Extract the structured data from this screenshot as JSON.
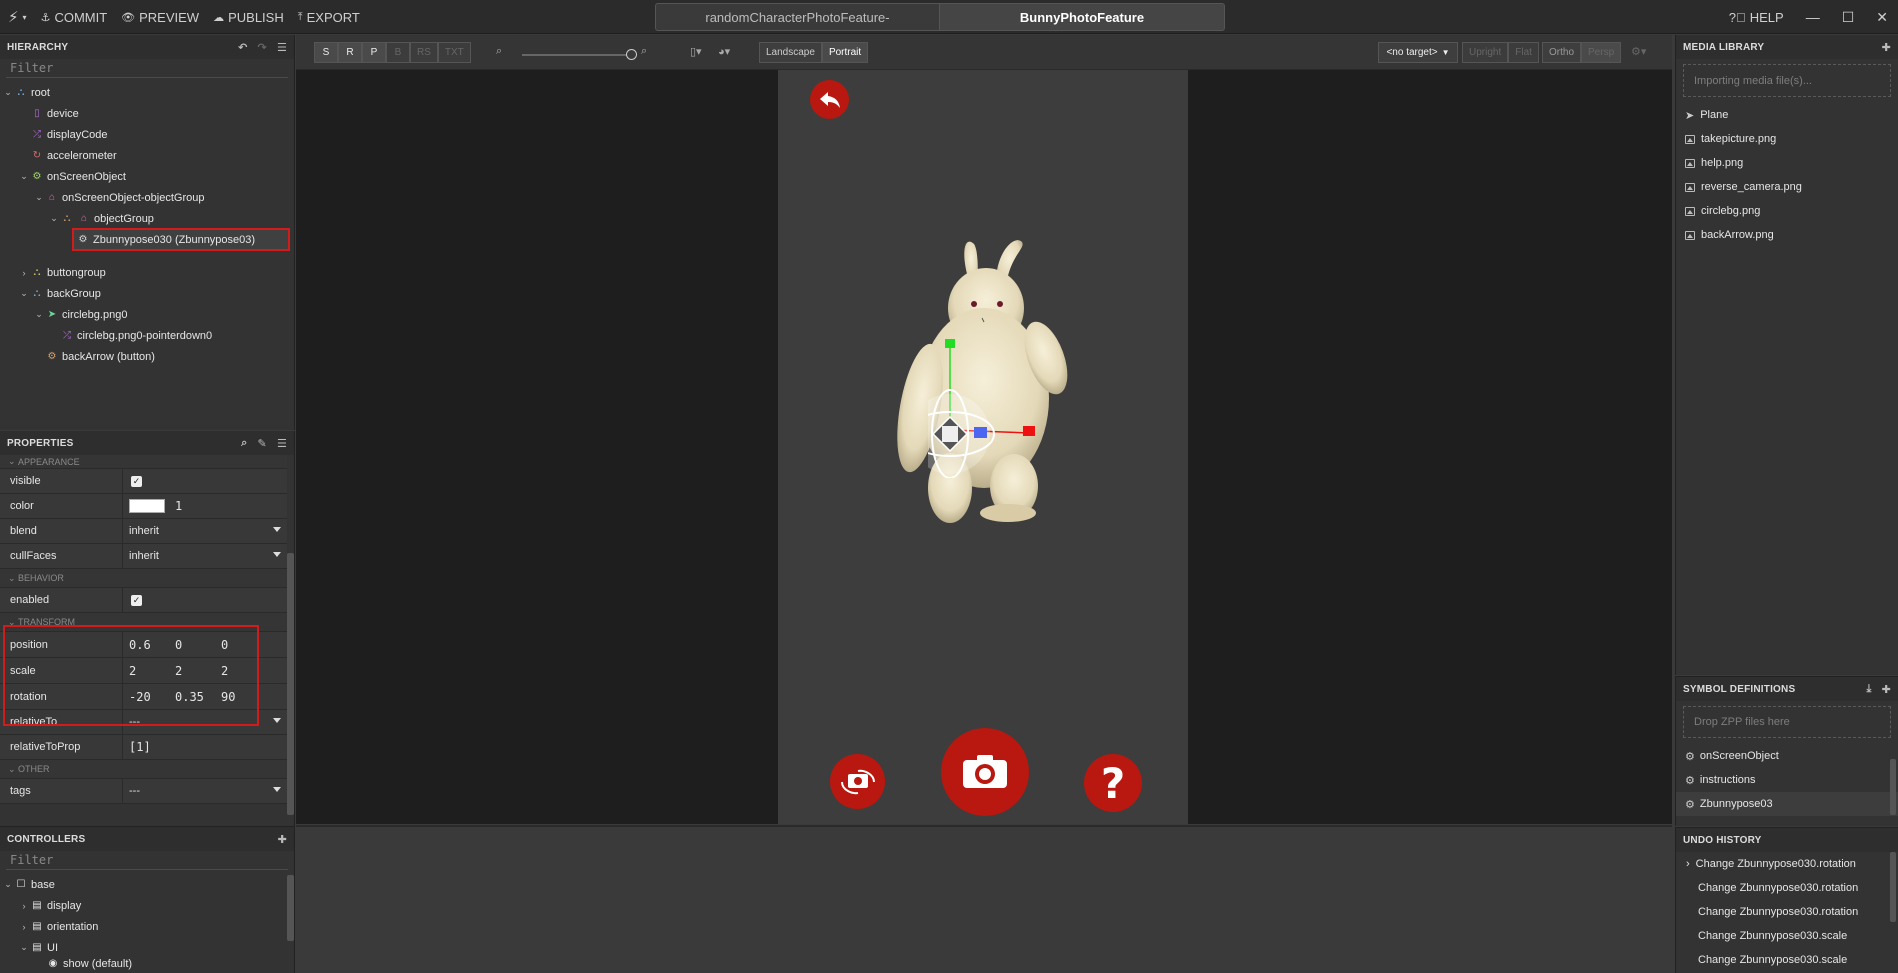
{
  "topbar": {
    "commit": "COMMIT",
    "preview": "PREVIEW",
    "publish": "PUBLISH",
    "export": "EXPORT",
    "tabs": [
      "randomCharacterPhotoFeature-",
      "BunnyPhotoFeature"
    ],
    "help": "HELP"
  },
  "hierarchy": {
    "title": "HIERARCHY",
    "filter_placeholder": "Filter",
    "items": [
      {
        "label": "root",
        "icon": "group-icon",
        "color": "#7ab3e0"
      },
      {
        "label": "device",
        "icon": "device-icon",
        "color": "#b26bd6"
      },
      {
        "label": "displayCode",
        "icon": "shuffle-icon",
        "color": "#b26bd6"
      },
      {
        "label": "accelerometer",
        "icon": "refresh-icon",
        "color": "#d66b6b"
      },
      {
        "label": "onScreenObject",
        "icon": "gear-icon",
        "color": "#9fd66b"
      },
      {
        "label": "onScreenObject-objectGroup",
        "icon": "tag-icon",
        "color": "#d66bb2"
      },
      {
        "label": "objectGroup",
        "icon": "group-icon",
        "color": "#d6a06b"
      },
      {
        "label": "Zbunnypose030 (Zbunnypose03)",
        "icon": "gear-icon",
        "color": "#d6d6d6"
      },
      {
        "label": "buttongroup",
        "icon": "group-icon",
        "color": "#d6c96b"
      },
      {
        "label": "backGroup",
        "icon": "group-icon",
        "color": "#7ab3e0"
      },
      {
        "label": "circlebg.png0",
        "icon": "plane-icon",
        "color": "#6bd69a"
      },
      {
        "label": "circlebg.png0-pointerdown0",
        "icon": "shuffle-icon",
        "color": "#b26bd6"
      },
      {
        "label": "backArrow (button)",
        "icon": "gear-icon",
        "color": "#d6a06b"
      }
    ]
  },
  "properties": {
    "title": "PROPERTIES",
    "sections": {
      "appearance": "APPEARANCE",
      "behavior": "BEHAVIOR",
      "transform": "TRANSFORM",
      "other": "OTHER"
    },
    "visible_label": "visible",
    "color_label": "color",
    "color_value": "1",
    "blend_label": "blend",
    "blend_value": "inherit",
    "cullfaces_label": "cullFaces",
    "cullfaces_value": "inherit",
    "enabled_label": "enabled",
    "position_label": "position",
    "position": [
      "0.6",
      "0",
      "0"
    ],
    "scale_label": "scale",
    "scale": [
      "2",
      "2",
      "2"
    ],
    "rotation_label": "rotation",
    "rotation": [
      "-20",
      "0.35",
      "90"
    ],
    "relativeto_label": "relativeTo",
    "relativeto_value": "---",
    "relativetoprop_label": "relativeToProp",
    "relativetoprop_value": "[1]",
    "tags_label": "tags",
    "tags_value": "---"
  },
  "controllers": {
    "title": "CONTROLLERS",
    "filter_placeholder": "Filter",
    "items": [
      "base",
      "display",
      "orientation",
      "UI",
      "show (default)"
    ]
  },
  "viewport_toolbar": {
    "modes": [
      "S",
      "R",
      "P",
      "B",
      "RS",
      "TXT"
    ],
    "landscape": "Landscape",
    "portrait": "Portrait",
    "target": "<no target>",
    "upright": "Upright",
    "flat": "Flat",
    "ortho": "Ortho",
    "persp": "Persp"
  },
  "media_library": {
    "title": "MEDIA LIBRARY",
    "drop_text": "Importing media file(s)...",
    "items": [
      "Plane",
      "takepicture.png",
      "help.png",
      "reverse_camera.png",
      "circlebg.png",
      "backArrow.png"
    ]
  },
  "symbol_definitions": {
    "title": "SYMBOL DEFINITIONS",
    "drop_text": "Drop ZPP files here",
    "items": [
      "onScreenObject",
      "instructions",
      "Zbunnypose03"
    ]
  },
  "undo_history": {
    "title": "UNDO HISTORY",
    "items": [
      "Change Zbunnypose030.rotation",
      "Change Zbunnypose030.rotation",
      "Change Zbunnypose030.rotation",
      "Change Zbunnypose030.scale",
      "Change Zbunnypose030.scale"
    ]
  },
  "colors": {
    "accent_red": "#b8180f",
    "selection_red": "#d21b1b",
    "gizmo_green": "#22dd22",
    "gizmo_red": "#ee1111",
    "gizmo_blue": "#1133ee"
  }
}
